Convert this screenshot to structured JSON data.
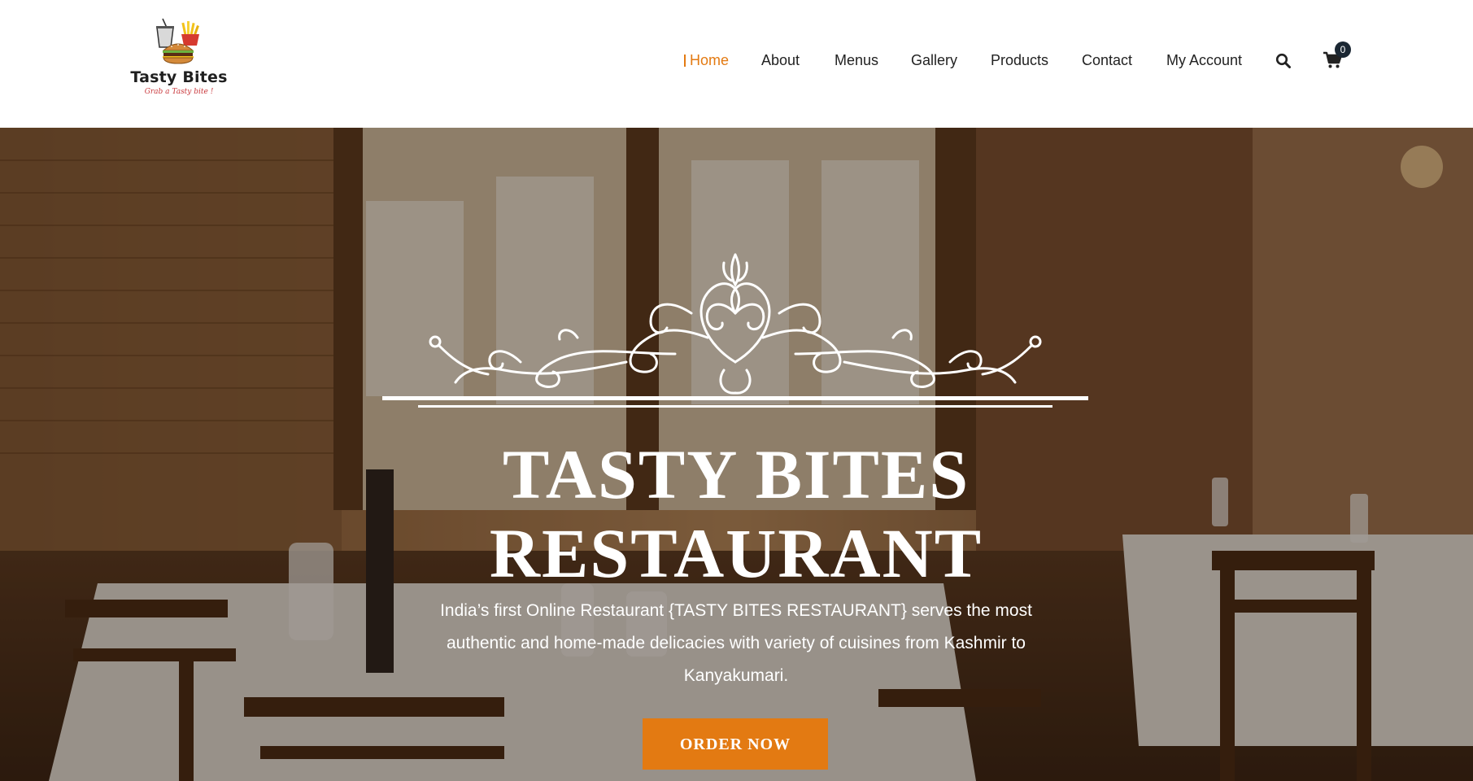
{
  "brand": {
    "name": "Tasty Bites",
    "tagline": "Grab a Tasty bite !"
  },
  "nav": {
    "items": [
      {
        "label": "Home",
        "active": true
      },
      {
        "label": "About"
      },
      {
        "label": "Menus"
      },
      {
        "label": "Gallery"
      },
      {
        "label": "Products"
      },
      {
        "label": "Contact"
      },
      {
        "label": "My Account"
      }
    ],
    "search_icon": "search-icon",
    "cart_icon": "cart-icon",
    "cart_count": "0"
  },
  "hero": {
    "title_line1": "TASTY BITES",
    "title_line2": "RESTAURANT",
    "description_line1": "India’s first Online Restaurant {TASTY BITES RESTAURANT} serves the most",
    "description_line2": "authentic and home-made delicacies with variety of cuisines from Kashmir to",
    "description_line3": "Kanyakumari.",
    "cta_label": "ORDER NOW",
    "background": "restaurant-interior-photo",
    "ornament": "decorative-flourish-divider"
  },
  "colors": {
    "accent": "#e37a12",
    "text": "#222222",
    "badge": "#1b2733",
    "white": "#ffffff"
  }
}
